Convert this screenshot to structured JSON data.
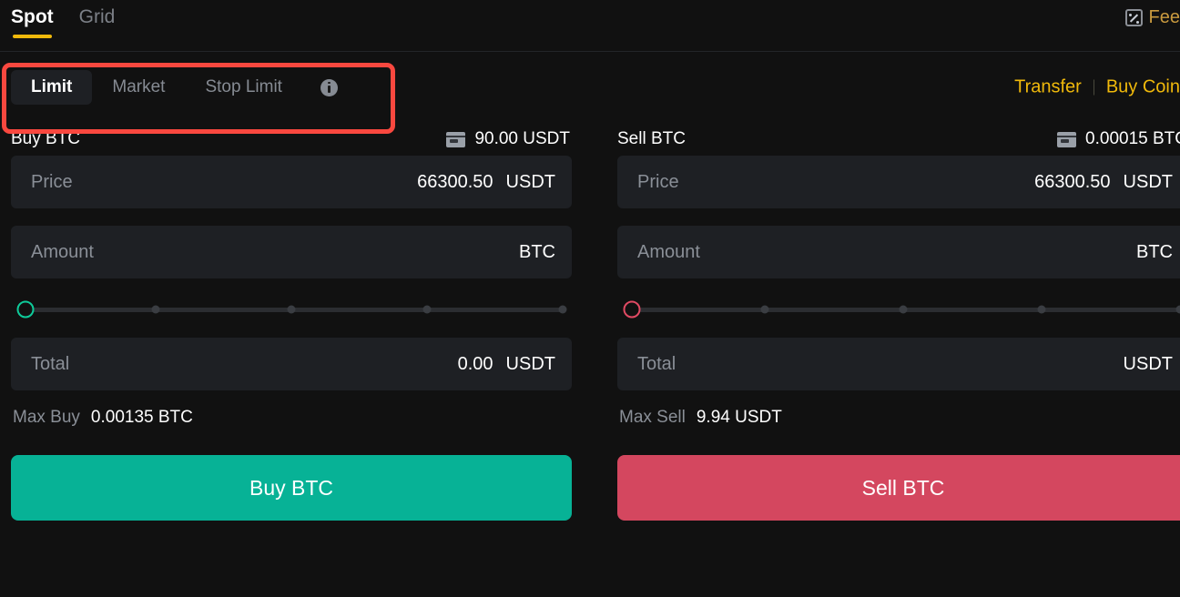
{
  "header": {
    "tabs": [
      {
        "label": "Spot",
        "active": true
      },
      {
        "label": "Grid",
        "active": false
      }
    ],
    "fee": {
      "label": "Fee",
      "icon": "percent-box-icon"
    },
    "accent_color": "#f0b90b"
  },
  "order_type": {
    "tabs": [
      {
        "label": "Limit",
        "active": true
      },
      {
        "label": "Market",
        "active": false
      },
      {
        "label": "Stop Limit",
        "active": false
      }
    ],
    "info_icon": "info-icon",
    "links": [
      {
        "label": "Transfer"
      },
      {
        "label": "Buy Coin"
      }
    ],
    "highlight_color": "#f9483f",
    "link_color": "#f0b90b"
  },
  "buy_panel": {
    "title": "Buy BTC",
    "balance": {
      "icon": "wallet-icon",
      "value": "90.00 USDT"
    },
    "price": {
      "label": "Price",
      "value": "66300.50",
      "unit": "USDT"
    },
    "amount": {
      "label": "Amount",
      "value": "",
      "unit": "BTC"
    },
    "slider": {
      "value": 0,
      "ticks": [
        25,
        50,
        75,
        100
      ],
      "handle_color": "#0ecb9a"
    },
    "total": {
      "label": "Total",
      "value": "0.00",
      "unit": "USDT"
    },
    "max": {
      "label": "Max Buy",
      "value": "0.00135 BTC"
    },
    "action": {
      "label": "Buy BTC",
      "color": "#07b296"
    }
  },
  "sell_panel": {
    "title": "Sell BTC",
    "balance": {
      "icon": "wallet-icon",
      "value": "0.00015 BTC"
    },
    "price": {
      "label": "Price",
      "value": "66300.50",
      "unit": "USDT"
    },
    "amount": {
      "label": "Amount",
      "value": "",
      "unit": "BTC"
    },
    "slider": {
      "value": 0,
      "ticks": [
        25,
        50,
        75,
        100
      ],
      "handle_color": "#e04a63"
    },
    "total": {
      "label": "Total",
      "value": "",
      "unit": "USDT"
    },
    "max": {
      "label": "Max Sell",
      "value": "9.94 USDT"
    },
    "action": {
      "label": "Sell BTC",
      "color": "#d4475f"
    }
  }
}
